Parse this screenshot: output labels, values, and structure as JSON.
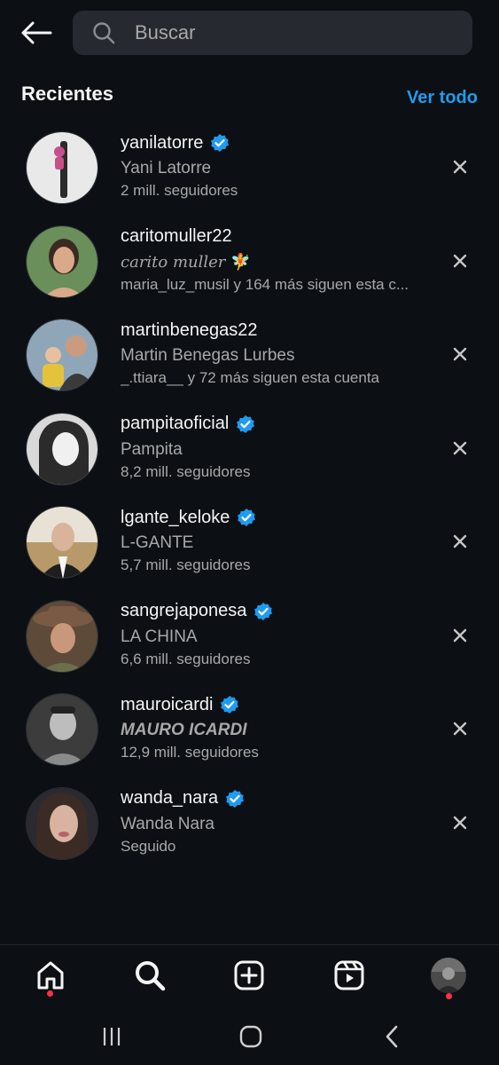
{
  "search": {
    "placeholder": "Buscar",
    "value": ""
  },
  "recents": {
    "title": "Recientes",
    "see_all": "Ver todo"
  },
  "accounts": [
    {
      "username": "yanilatorre",
      "verified": true,
      "name": "Yani Latorre",
      "meta": "2 mill. seguidores",
      "bg": "#e9e9e9",
      "fg": "#c74f8c"
    },
    {
      "username": "caritomuller22",
      "verified": false,
      "name": "carito muller",
      "name_emoji": "🧚",
      "meta": "maria_luz_musil y 164 más siguen esta c...",
      "bg": "#6a8f5b",
      "fg": "#3a2a22"
    },
    {
      "username": "martinbenegas22",
      "verified": false,
      "name": "Martin Benegas Lurbes",
      "meta": "_.ttiara__ y 72 más siguen esta cuenta",
      "bg": "#8fa6b8",
      "fg": "#e4c23b"
    },
    {
      "username": "pampitaoficial",
      "verified": true,
      "name": "Pampita",
      "meta": "8,2 mill. seguidores",
      "bg": "#d9d9d9",
      "fg": "#2b2b2b"
    },
    {
      "username": "lgante_keloke",
      "verified": true,
      "name": "L-GANTE",
      "meta": "5,7 mill. seguidores",
      "bg": "#b89a6a",
      "fg": "#1e1e1e"
    },
    {
      "username": "sangrejaponesa",
      "verified": true,
      "name": "LA CHINA",
      "meta": "6,6 mill. seguidores",
      "bg": "#5e4a38",
      "fg": "#c9987a"
    },
    {
      "username": "mauroicardi",
      "verified": true,
      "name": "MAURO ICARDI",
      "meta": "12,9 mill. seguidores",
      "bg": "#3c3c3c",
      "fg": "#bdbdbd"
    },
    {
      "username": "wanda_nara",
      "verified": true,
      "name": "Wanda Nara",
      "meta": "Seguido",
      "bg": "#2a2a30",
      "fg": "#d8b4a0"
    }
  ],
  "nav": {
    "items": [
      "home-icon",
      "search-icon",
      "create-icon",
      "reels-icon",
      "profile-icon"
    ],
    "active": "search-icon"
  },
  "colors": {
    "background": "#0c1014",
    "accent": "#1f9bf0",
    "verified": "#1f9bf0",
    "notification_dot": "#ff3040",
    "secondary_text": "#a8a8a8"
  }
}
